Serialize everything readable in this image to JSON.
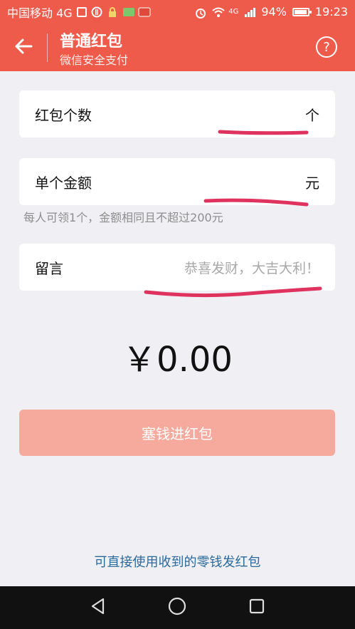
{
  "status_bar": {
    "carrier": "中国移动 4G",
    "network_badge": "4G",
    "battery": "94%",
    "time": "19:23"
  },
  "header": {
    "title": "普通红包",
    "subtitle": "微信安全支付",
    "help": "?"
  },
  "form": {
    "count_label": "红包个数",
    "count_unit": "个",
    "amount_label": "单个金额",
    "amount_unit": "元",
    "hint": "每人可领1个，金额相同且不超过200元",
    "message_label": "留言",
    "message_placeholder": "恭喜发财，大吉大利！"
  },
  "total": "￥0.00",
  "submit_label": "塞钱进红包",
  "bottom_link": "可直接使用收到的零钱发红包",
  "icons": {
    "back": "arrow-left-icon",
    "help": "question-circle-icon"
  },
  "colors": {
    "primary": "#ef5b4b",
    "button_disabled": "#f6aa9d",
    "link": "#2b6a9b"
  }
}
